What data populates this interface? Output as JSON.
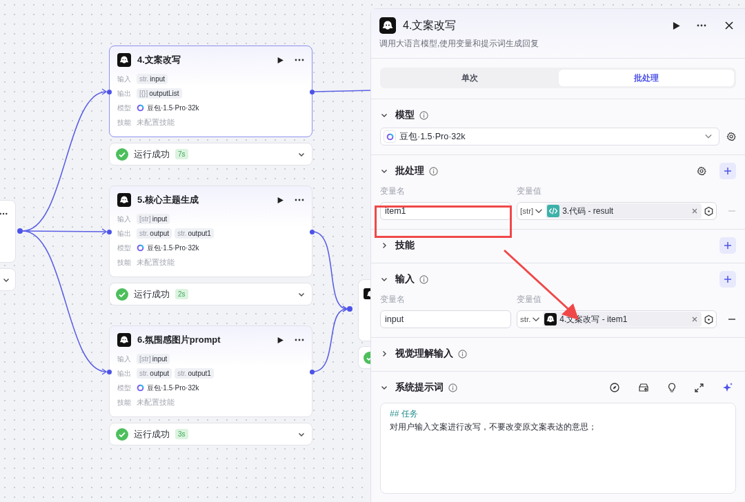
{
  "canvas": {
    "nodes": [
      {
        "title": "4.文案改写",
        "selected": true,
        "rows": [
          {
            "label": "输入",
            "kind": "tags",
            "tags": [
              {
                "type": "str.",
                "name": "input"
              }
            ]
          },
          {
            "label": "输出",
            "kind": "tags",
            "tags": [
              {
                "type": "[{}]",
                "name": "outputList"
              }
            ]
          },
          {
            "label": "模型",
            "kind": "model",
            "text": "豆包·1.5·Pro·32k"
          },
          {
            "label": "技能",
            "kind": "empty",
            "text": "未配置技能"
          }
        ],
        "status": {
          "text": "运行成功",
          "time": "7s",
          "success": true
        }
      },
      {
        "title": "5.核心主题生成",
        "selected": false,
        "rows": [
          {
            "label": "输入",
            "kind": "tags",
            "tags": [
              {
                "type": "[str]",
                "name": "input"
              }
            ]
          },
          {
            "label": "输出",
            "kind": "tags",
            "tags": [
              {
                "type": "str.",
                "name": "output"
              },
              {
                "type": "str.",
                "name": "output1"
              }
            ]
          },
          {
            "label": "模型",
            "kind": "model",
            "text": "豆包·1.5·Pro·32k"
          },
          {
            "label": "技能",
            "kind": "empty",
            "text": "未配置技能"
          }
        ],
        "status": {
          "text": "运行成功",
          "time": "2s",
          "success": true
        }
      },
      {
        "title": "6.氛围感图片prompt",
        "selected": false,
        "rows": [
          {
            "label": "输入",
            "kind": "tags",
            "tags": [
              {
                "type": "[str]",
                "name": "input"
              }
            ]
          },
          {
            "label": "输出",
            "kind": "tags",
            "tags": [
              {
                "type": "str.",
                "name": "output"
              },
              {
                "type": "str.",
                "name": "output1"
              }
            ]
          },
          {
            "label": "模型",
            "kind": "model",
            "text": "豆包·1.5·Pro·32k"
          },
          {
            "label": "技能",
            "kind": "empty",
            "text": "未配置技能"
          }
        ],
        "status": {
          "text": "运行成功",
          "time": "3s",
          "success": true
        }
      }
    ]
  },
  "panel": {
    "title": "4.文案改写",
    "description": "调用大语言模型,使用变量和提示词生成回复",
    "tabs": [
      {
        "label": "单次",
        "selected": false
      },
      {
        "label": "批处理",
        "selected": true
      }
    ],
    "sections": [
      {
        "kind": "model",
        "title": "模型",
        "expanded": true,
        "info": true,
        "model": "豆包·1.5·Pro·32k"
      },
      {
        "kind": "batch",
        "title": "批处理",
        "expanded": true,
        "info": true,
        "columns": [
          "变量名",
          "变量值"
        ],
        "rows": [
          {
            "name": "item1",
            "type": "[str]",
            "kind": "code",
            "ref": "3.代码 - result",
            "removable": false
          }
        ]
      },
      {
        "kind": "skills",
        "title": "技能",
        "expanded": false,
        "info": false
      },
      {
        "kind": "inputs",
        "title": "输入",
        "expanded": true,
        "info": true,
        "columns": [
          "变量名",
          "变量值"
        ],
        "rows": [
          {
            "name": "input",
            "type": "str.",
            "kind": "llm",
            "ref": "4.文案改写 - item1",
            "removable": true
          }
        ]
      },
      {
        "kind": "vision",
        "title": "视觉理解输入",
        "expanded": false,
        "info": true
      },
      {
        "kind": "prompt",
        "title": "系统提示词",
        "expanded": true,
        "info": true,
        "heading": "## 任务",
        "body": "对用户输入文案进行改写，不要改变原文案表达的意思；"
      }
    ]
  },
  "annotations": {
    "highlight_box": true,
    "arrow": true
  }
}
